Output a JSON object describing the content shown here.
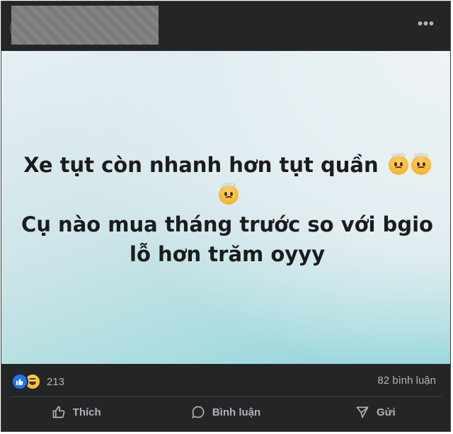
{
  "post": {
    "menu_icon": "more-horizontal-icon",
    "image_text": {
      "line1": "Xe tụt còn nhanh hơn tụt quần",
      "line2": "Cụ nào mua tháng trước so với bgio",
      "line3": "lỗ hơn trăm oyyy",
      "emoji": "worried-face-with-halo-icon"
    },
    "background_colors": [
      "#e6eff3",
      "#8fd5d9"
    ]
  },
  "stats": {
    "reaction_count": "213",
    "comment_count": "82 bình luận"
  },
  "actions": {
    "like_label": "Thích",
    "comment_label": "Bình luận",
    "share_label": "Gửi"
  },
  "colors": {
    "card_bg": "#242526",
    "secondary_text": "#b0b3b8",
    "like_blue": "#1877f2"
  }
}
